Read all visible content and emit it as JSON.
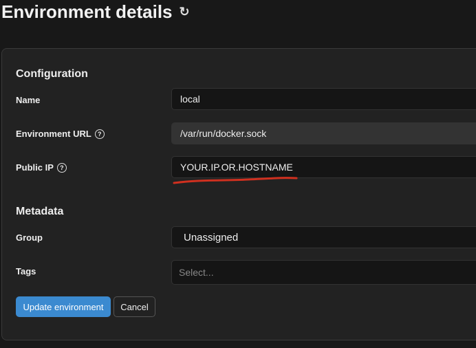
{
  "header": {
    "title": "Environment details",
    "refresh_icon": "refresh-icon"
  },
  "configuration": {
    "heading": "Configuration",
    "name": {
      "label": "Name",
      "value": "local"
    },
    "url": {
      "label": "Environment URL",
      "value": "/var/run/docker.sock",
      "help": "?"
    },
    "public_ip": {
      "label": "Public IP",
      "value": "YOUR.IP.OR.HOSTNAME",
      "help": "?"
    }
  },
  "metadata": {
    "heading": "Metadata",
    "group": {
      "label": "Group",
      "value": "Unassigned"
    },
    "tags": {
      "label": "Tags",
      "placeholder": "Select..."
    }
  },
  "actions": {
    "update": "Update environment",
    "cancel": "Cancel"
  },
  "colors": {
    "primary": "#3b8ad0",
    "annotation": "#d0301f"
  }
}
